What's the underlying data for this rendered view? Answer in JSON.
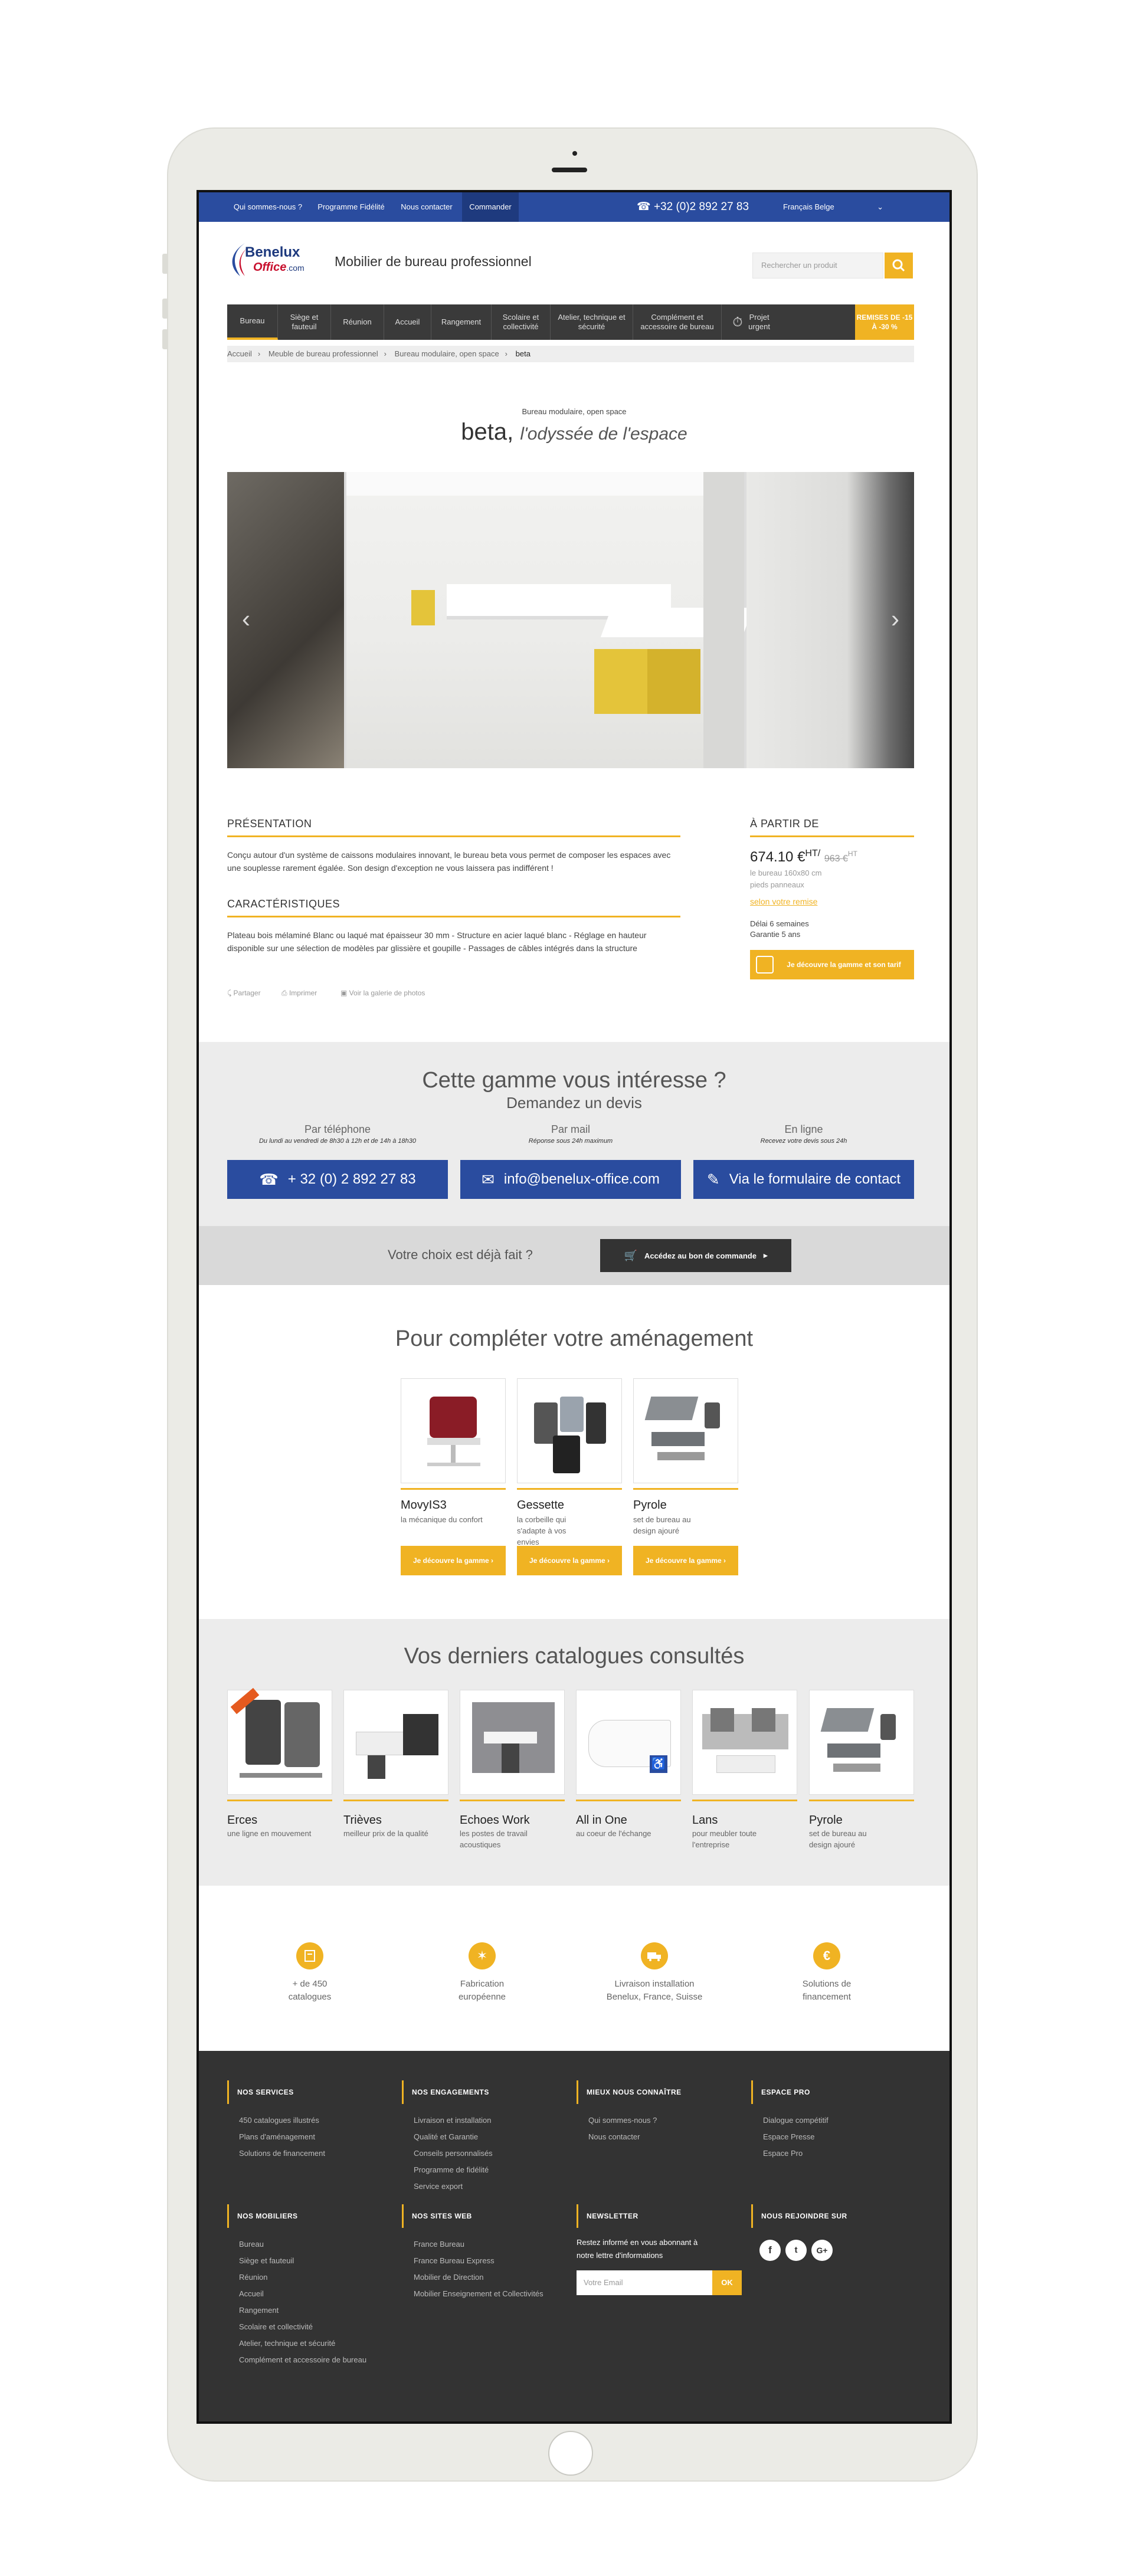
{
  "topbar": {
    "links": [
      "Qui sommes-nous ?",
      "Programme Fidélité",
      "Nous contacter",
      "Commander"
    ],
    "phone": "+32 (0)2 892 27 83",
    "language": "Français Belge"
  },
  "header": {
    "logo_line1": "Benelux",
    "logo_line2": "Office",
    "logo_suffix": ".com",
    "tagline": "Mobilier de bureau professionnel",
    "search_placeholder": "Rechercher un produit"
  },
  "nav": {
    "items": [
      "Bureau",
      "Siège et fauteuil",
      "Réunion",
      "Accueil",
      "Rangement",
      "Scolaire et collectivité",
      "Atelier, technique et sécurité",
      "Complément et accessoire de bureau",
      "Projet urgent"
    ],
    "promo": "REMISES DE -15 À -30 %"
  },
  "breadcrumb": [
    "Accueil",
    "Meuble de bureau professionnel",
    "Bureau modulaire, open space",
    "beta"
  ],
  "hero": {
    "kicker": "Bureau modulaire, open space",
    "title": "beta,",
    "subtitle": "l'odyssée de l'espace"
  },
  "presentation": {
    "title": "PRÉSENTATION",
    "text": "Conçu autour d'un système de caissons modulaires innovant, le bureau beta vous permet de composer les espaces avec une souplesse rarement égalée. Son design d'exception ne vous laissera pas indifférent !"
  },
  "caracteristiques": {
    "title": "CARACTÉRISTIQUES",
    "text": "Plateau bois mélaminé Blanc ou laqué mat épaisseur 30 mm - Structure en acier laqué blanc - Réglage en hauteur disponible sur une sélection de modèles par glissière et goupille - Passages de câbles intégrés dans la structure"
  },
  "share_links": [
    "Partager",
    "Imprimer",
    "Voir la galerie de photos"
  ],
  "pricing": {
    "title": "À PARTIR DE",
    "price": "674.10 €",
    "price_ht": "HT/",
    "old_price": "963 €",
    "old_ht": "HT",
    "note1": "le bureau 160x80 cm",
    "note2": "pieds panneaux",
    "remise": "selon votre remise",
    "delai": "Délai 6 semaines",
    "garantie": "Garantie 5 ans",
    "cta": "Je découvre la gamme et son tarif"
  },
  "devis": {
    "title": "Cette gamme vous intéresse ?",
    "subtitle": "Demandez un devis",
    "channels": [
      {
        "label": "Par téléphone",
        "note": "Du lundi au vendredi de 8h30 à 12h et de 14h à 18h30",
        "button": "+ 32 (0) 2 892 27 83"
      },
      {
        "label": "Par mail",
        "note": "Réponse sous 24h maximum",
        "button": "info@benelux-office.com"
      },
      {
        "label": "En ligne",
        "note": "Recevez votre devis sous 24h",
        "button": "Via le formulaire de contact"
      }
    ]
  },
  "order": {
    "question": "Votre choix est déjà fait ?",
    "button": "Accédez au bon de commande"
  },
  "complete": {
    "title": "Pour compléter votre aménagement",
    "products": [
      {
        "name": "MovyIS3",
        "desc": "la mécanique du confort",
        "button": "Je découvre la gamme"
      },
      {
        "name": "Gessette",
        "desc": "la corbeille qui s'adapte à vos envies",
        "button": "Je découvre la gamme"
      },
      {
        "name": "Pyrole",
        "desc": "set de bureau au design ajouré",
        "button": "Je découvre la gamme"
      }
    ]
  },
  "catalogues": {
    "title": "Vos derniers catalogues consultés",
    "items": [
      {
        "name": "Erces",
        "desc": "une ligne en mouvement"
      },
      {
        "name": "Trièves",
        "desc": "meilleur prix de la qualité"
      },
      {
        "name": "Echoes Work",
        "desc": "les postes de travail acoustiques"
      },
      {
        "name": "All in One",
        "desc": "au coeur de l'échange"
      },
      {
        "name": "Lans",
        "desc": "pour meubler toute l'entreprise"
      },
      {
        "name": "Pyrole",
        "desc": "set de bureau au design ajouré"
      }
    ]
  },
  "features": [
    {
      "icon": "catalog-icon",
      "l1": "+ de 450",
      "l2": "catalogues"
    },
    {
      "icon": "star-icon",
      "l1": "Fabrication",
      "l2": "européenne"
    },
    {
      "icon": "truck-icon",
      "l1": "Livraison installation",
      "l2": "Benelux, France, Suisse"
    },
    {
      "icon": "euro-icon",
      "l1": "Solutions de",
      "l2": "financement"
    }
  ],
  "footer": {
    "services": {
      "title": "NOS SERVICES",
      "links": [
        "450 catalogues illustrés",
        "Plans d'aménagement",
        "Solutions de financement"
      ]
    },
    "engagements": {
      "title": "NOS ENGAGEMENTS",
      "links": [
        "Livraison et installation",
        "Qualité et Garantie",
        "Conseils personnalisés",
        "Programme de fidélité",
        "Service export"
      ]
    },
    "connaitre": {
      "title": "MIEUX NOUS CONNAÎTRE",
      "links": [
        "Qui sommes-nous ?",
        "Nous contacter"
      ]
    },
    "pro": {
      "title": "ESPACE PRO",
      "links": [
        "Dialogue compétitif",
        "Espace Presse",
        "Espace Pro"
      ]
    },
    "mobiliers": {
      "title": "NOS MOBILIERS",
      "links": [
        "Bureau",
        "Siège et fauteuil",
        "Réunion",
        "Accueil",
        "Rangement",
        "Scolaire et collectivité",
        "Atelier, technique et sécurité",
        "Complément et accessoire de bureau"
      ]
    },
    "sites": {
      "title": "NOS SITES WEB",
      "links": [
        "France Bureau",
        "France Bureau Express",
        "Mobilier de Direction",
        "Mobilier Enseignement et Collectivités"
      ]
    },
    "newsletter": {
      "title": "NEWSLETTER",
      "text1": "Restez informé en vous abonnant à",
      "text2": "notre lettre d'informations",
      "placeholder": "Votre Email",
      "button": "OK"
    },
    "social": {
      "title": "NOUS REJOINDRE SUR",
      "networks": [
        "f",
        "t",
        "G+"
      ]
    }
  },
  "colors": {
    "blue": "#2a4c9f",
    "yellow": "#f0b323",
    "dark": "#333333"
  }
}
